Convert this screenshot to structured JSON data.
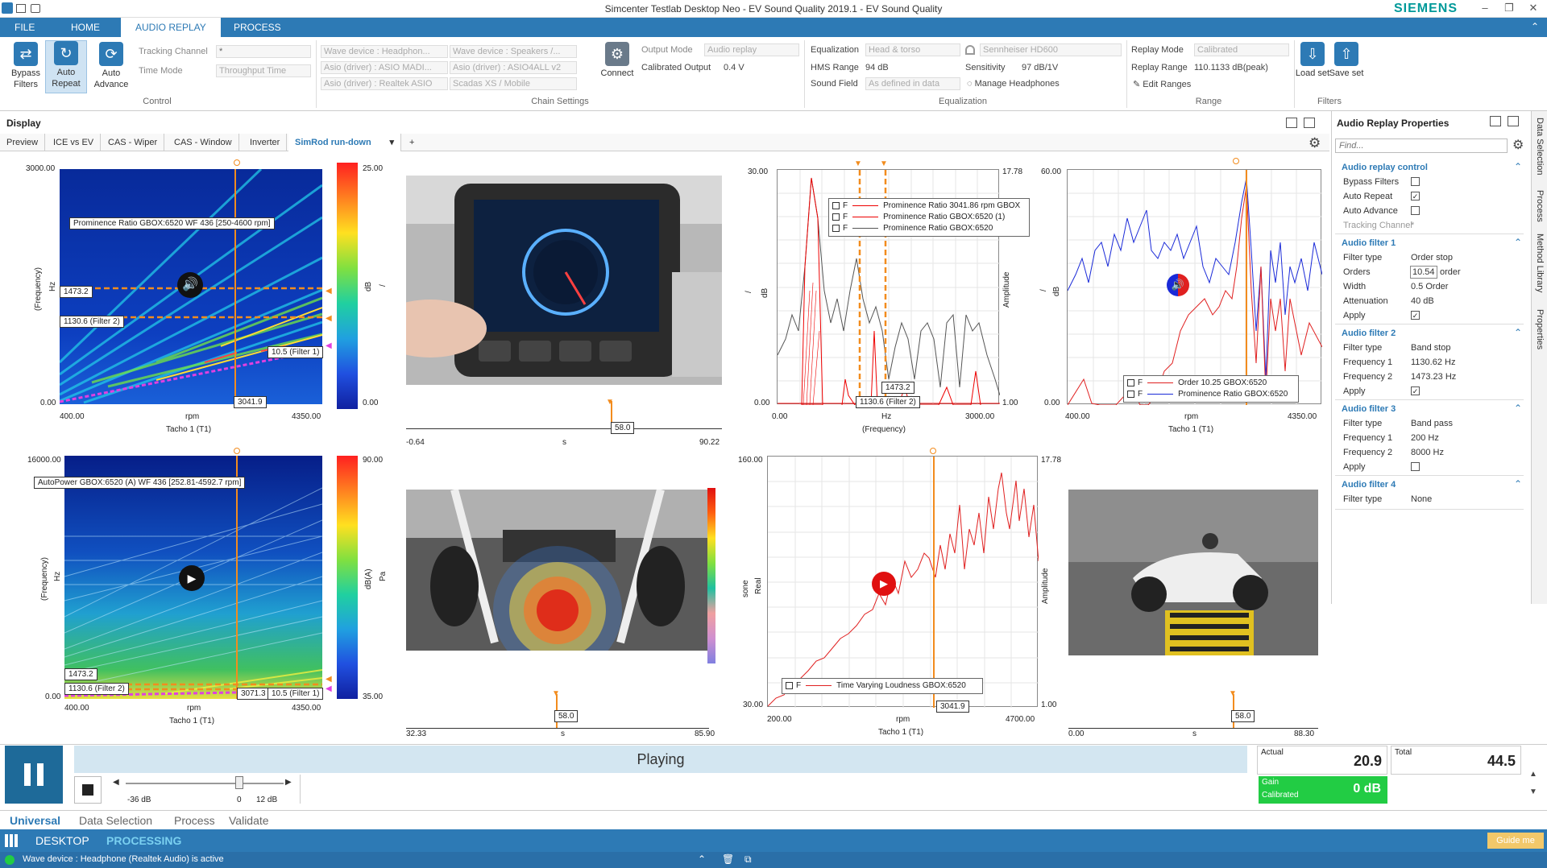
{
  "window": {
    "title": "Simcenter Testlab Desktop Neo - EV Sound Quality 2019.1 - EV Sound Quality",
    "brand": "SIEMENS"
  },
  "menu": {
    "tabs": [
      "FILE",
      "HOME",
      "AUDIO REPLAY",
      "PROCESS"
    ],
    "active": "AUDIO REPLAY"
  },
  "ribbon": {
    "control": {
      "buttons": [
        "Bypass Filters",
        "Auto Repeat",
        "Auto Advance"
      ],
      "tracking_channel_label": "Tracking Channel",
      "tracking_channel_value": "*",
      "time_mode_label": "Time Mode",
      "time_mode_value": "Throughput Time",
      "group": "Control"
    },
    "chain": {
      "devices": [
        "Wave device : Headphon...",
        "Wave device : Speakers /...",
        "Asio (driver) : ASIO MADI...",
        "Asio (driver) : ASIO4ALL v2",
        "Asio (driver) : Realtek ASIO",
        "Scadas XS / Mobile"
      ],
      "connect": "Connect",
      "output_mode_label": "Output Mode",
      "output_mode_value": "Audio replay",
      "calibrated_output_label": "Calibrated Output",
      "calibrated_output_value": "0.4  V",
      "group": "Chain Settings"
    },
    "equalization": {
      "eq_label": "Equalization",
      "eq_value": "Head & torso",
      "headphone_value": "Sennheiser HD600",
      "hms_range_label": "HMS Range",
      "hms_range_value": "94  dB",
      "sensitivity_label": "Sensitivity",
      "sensitivity_value": "97  dB/1V",
      "sound_field_label": "Sound Field",
      "sound_field_value": "As defined in data",
      "manage": "Manage Headphones",
      "group": "Equalization"
    },
    "range": {
      "replay_mode_label": "Replay Mode",
      "replay_mode_value": "Calibrated",
      "replay_range_label": "Replay Range",
      "replay_range_value": "110.1133  dB(peak)",
      "edit": "Edit Ranges",
      "group": "Range"
    },
    "filters": {
      "buttons": [
        "Load set",
        "Save set"
      ],
      "group": "Filters"
    }
  },
  "display": {
    "label": "Display",
    "tabs": [
      "Preview",
      "ICE vs EV",
      "CAS - Wiper",
      "CAS - Window",
      "Inverter",
      "SimRod run-down"
    ],
    "active_tab": "SimRod run-down",
    "add": "+"
  },
  "plots": {
    "p1": {
      "ytop": "3000.00",
      "ybot": "0.00",
      "xl": "400.00",
      "xr": "4350.00",
      "xmid": "rpm",
      "xname": "Tacho 1 (T1)",
      "yname": "(Frequency)",
      "yunit": "Hz",
      "title": "Prominence Ratio GBOX:6520 WF 436 [250-4600 rpm]",
      "c1": "1473.2",
      "c2": "1130.6 (Filter 2)",
      "c3": "10.5 (Filter 1)",
      "cursor": "3041.9",
      "cb_top": "25.00",
      "cb_bot": "0.00",
      "cb_unit": "dB",
      "cb_sym": "/"
    },
    "p2": {
      "xl": "-0.64",
      "xr": "90.22",
      "xunit": "s",
      "cursor": "58.0"
    },
    "p3": {
      "ytop": "30.00",
      "ybot": "0.00",
      "rtop": "17.78",
      "rbot": "1.00",
      "xl": "0.00",
      "xr": "3000.00",
      "xmid": "Hz",
      "xname": "(Frequency)",
      "yunit": "dB",
      "ysym": "/",
      "rname": "Amplitude",
      "legend": [
        "Prominence Ratio 3041.86 rpm GBOX",
        "Prominence Ratio GBOX:6520 (1)",
        "Prominence Ratio GBOX:6520"
      ],
      "c1": "1473.2",
      "c2": "1130.6 (Filter 2)"
    },
    "p4": {
      "ytop": "60.00",
      "ybot": "0.00",
      "xl": "400.00",
      "xr": "4350.00",
      "xmid": "rpm",
      "xname": "Tacho 1 (T1)",
      "yunit": "dB",
      "ysym": "/",
      "legend": [
        "Order 10.25 GBOX:6520",
        "Prominence Ratio GBOX:6520"
      ]
    },
    "p5": {
      "ytop": "16000.00",
      "ybot": "0.00",
      "xl": "400.00",
      "xr": "4350.00",
      "xmid": "rpm",
      "xname": "Tacho 1 (T1)",
      "yname": "(Frequency)",
      "yunit": "Hz",
      "title": "AutoPower GBOX:6520 (A) WF 436 [252.81-4592.7 rpm]",
      "c1": "1473.2",
      "c2": "1130.6 (Filter 2)",
      "c3": "10.5 (Filter 1)",
      "cursor": "3071.3",
      "cb_top": "90.00",
      "cb_bot": "35.00",
      "cb_unit": "dB(A)",
      "cb_sym": "Pa"
    },
    "p6": {
      "xl": "32.33",
      "xr": "85.90",
      "xunit": "s",
      "cursor": "58.0"
    },
    "p7": {
      "ytop": "160.00",
      "ybot": "30.00",
      "rtop": "17.78",
      "rbot": "1.00",
      "xl": "200.00",
      "xr": "4700.00",
      "xmid": "rpm",
      "xname": "Tacho 1 (T1)",
      "yunit": "sone",
      "ysym": "Real",
      "rname": "Amplitude",
      "legend": [
        "Time Varying Loudness GBOX:6520"
      ],
      "cursor": "3041.9"
    },
    "p8": {
      "xl": "0.00",
      "xr": "88.30",
      "xunit": "s",
      "cursor": "58.0"
    }
  },
  "properties": {
    "title": "Audio Replay Properties",
    "find_placeholder": "Find...",
    "control": {
      "title": "Audio replay control",
      "bypass": "Bypass Filters",
      "repeat": "Auto Repeat",
      "advance": "Auto Advance",
      "tracking": "Tracking Channel",
      "tracking_val": "*"
    },
    "f1": {
      "title": "Audio filter 1",
      "type_l": "Filter type",
      "type_v": "Order stop",
      "orders_l": "Orders",
      "orders_v": "10.54",
      "orders_u": "order",
      "width_l": "Width",
      "width_v": "0.5  Order",
      "att_l": "Attenuation",
      "att_v": "40  dB",
      "apply": "Apply"
    },
    "f2": {
      "title": "Audio filter 2",
      "type_l": "Filter type",
      "type_v": "Band stop",
      "f1_l": "Frequency 1",
      "f1_v": "1130.62  Hz",
      "f2_l": "Frequency 2",
      "f2_v": "1473.23  Hz",
      "apply": "Apply"
    },
    "f3": {
      "title": "Audio filter 3",
      "type_l": "Filter type",
      "type_v": "Band pass",
      "f1_l": "Frequency 1",
      "f1_v": "200  Hz",
      "f2_l": "Frequency 2",
      "f2_v": "8000  Hz",
      "apply": "Apply"
    },
    "f4": {
      "title": "Audio filter 4",
      "type_l": "Filter type",
      "type_v": "None"
    }
  },
  "side_tabs": [
    "Data Selection",
    "Process",
    "Method Library",
    "Properties"
  ],
  "transport": {
    "status": "Playing",
    "slider_min": "-36 dB",
    "slider_mid": "0",
    "slider_max": "12 dB",
    "actual_label": "Actual",
    "actual_value": "20.9",
    "total_label": "Total",
    "total_value": "44.5",
    "gain_label": "Gain",
    "gain_sub": "Calibrated",
    "gain_value": "0 dB"
  },
  "bottom_tabs": [
    "Universal",
    "Data Selection",
    "Process",
    "Validate"
  ],
  "appbar": {
    "desktop": "DESKTOP",
    "processing": "PROCESSING",
    "guide": "Guide me"
  },
  "status": {
    "text": "Wave device : Headphone (Realtek Audio) is active"
  },
  "colors": {
    "accent": "#2d7ab5",
    "orange": "#f28c1e",
    "gain_green": "#22cc44"
  }
}
